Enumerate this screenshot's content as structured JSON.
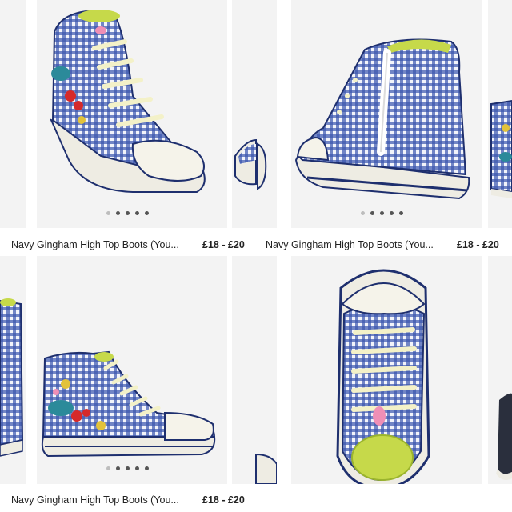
{
  "products": [
    {
      "title": "Navy Gingham High Top Boots (You...",
      "price": "£18 - £20"
    },
    {
      "title": "Navy Gingham High Top Boots (You...",
      "price": "£18 - £20"
    },
    {
      "title": "Navy Gingham High Top Boots (You...",
      "price": "£18 - £20"
    }
  ],
  "colors": {
    "navy": "#1e2f6e",
    "gingham_blue": "#2c48a0",
    "lime": "#c6d94a",
    "sole": "#eeece3"
  },
  "icons": [
    "pagination-dots",
    "shoe-image"
  ]
}
